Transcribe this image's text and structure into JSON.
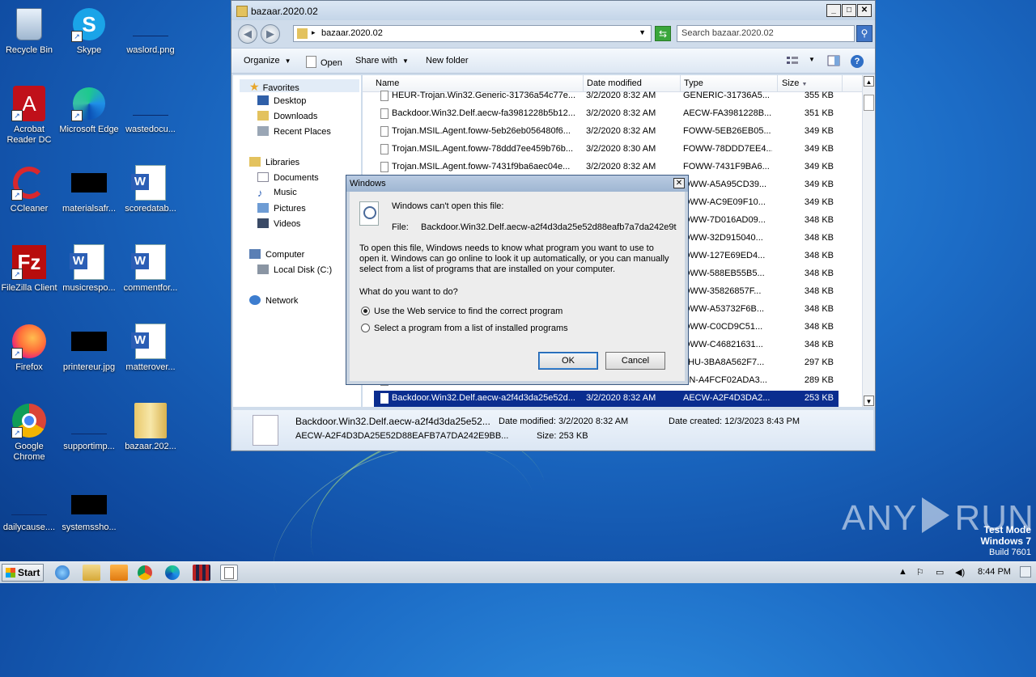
{
  "desktop": {
    "icons": [
      {
        "label": "Recycle Bin"
      },
      {
        "label": "Skype"
      },
      {
        "label": "waslord.png"
      },
      {
        "label": "Acrobat Reader DC"
      },
      {
        "label": "Microsoft Edge"
      },
      {
        "label": "wastedocu..."
      },
      {
        "label": "CCleaner"
      },
      {
        "label": "materialsafr..."
      },
      {
        "label": "scoredatab..."
      },
      {
        "label": "FileZilla Client"
      },
      {
        "label": "musicrespo..."
      },
      {
        "label": "commentfor..."
      },
      {
        "label": "Firefox"
      },
      {
        "label": "printereur.jpg"
      },
      {
        "label": "matterover..."
      },
      {
        "label": "Google Chrome"
      },
      {
        "label": "supportimp..."
      },
      {
        "label": "bazaar.202..."
      },
      {
        "label": "dailycause...."
      },
      {
        "label": "systemssho..."
      }
    ]
  },
  "explorer": {
    "title": "bazaar.2020.02",
    "address": "bazaar.2020.02",
    "search_placeholder": "Search bazaar.2020.02",
    "commands": {
      "organize": "Organize",
      "open": "Open",
      "share_with": "Share with",
      "new_folder": "New folder"
    },
    "nav": {
      "favorites": "Favorites",
      "desktop": "Desktop",
      "downloads": "Downloads",
      "recent_places": "Recent Places",
      "libraries": "Libraries",
      "documents": "Documents",
      "music": "Music",
      "pictures": "Pictures",
      "videos": "Videos",
      "computer": "Computer",
      "local_disk": "Local Disk (C:)",
      "network": "Network"
    },
    "columns": {
      "name": "Name",
      "date_modified": "Date modified",
      "type": "Type",
      "size": "Size"
    },
    "rows": [
      {
        "name": "HEUR-Trojan.Win32.Generic-31736a54c77e...",
        "date": "3/2/2020 8:32 AM",
        "type": "GENERIC-31736A5...",
        "size": "355 KB"
      },
      {
        "name": "Backdoor.Win32.Delf.aecw-fa3981228b5b12...",
        "date": "3/2/2020 8:32 AM",
        "type": "AECW-FA3981228B...",
        "size": "351 KB"
      },
      {
        "name": "Trojan.MSIL.Agent.foww-5eb26eb056480f6...",
        "date": "3/2/2020 8:32 AM",
        "type": "FOWW-5EB26EB05...",
        "size": "349 KB"
      },
      {
        "name": "Trojan.MSIL.Agent.foww-78ddd7ee459b76b...",
        "date": "3/2/2020 8:30 AM",
        "type": "FOWW-78DDD7EE4...",
        "size": "349 KB"
      },
      {
        "name": "Trojan.MSIL.Agent.foww-7431f9ba6aec04e...",
        "date": "3/2/2020 8:32 AM",
        "type": "FOWW-7431F9BA6...",
        "size": "349 KB"
      },
      {
        "name": "",
        "date": "",
        "type": "OWW-A5A95CD39...",
        "size": "349 KB"
      },
      {
        "name": "",
        "date": "",
        "type": "OWW-AC9E09F10...",
        "size": "349 KB"
      },
      {
        "name": "",
        "date": "",
        "type": "OWW-7D016AD09...",
        "size": "348 KB"
      },
      {
        "name": "",
        "date": "",
        "type": "OWW-32D915040...",
        "size": "348 KB"
      },
      {
        "name": "",
        "date": "",
        "type": "OWW-127E69ED4...",
        "size": "348 KB"
      },
      {
        "name": "",
        "date": "",
        "type": "OWW-588EB55B5...",
        "size": "348 KB"
      },
      {
        "name": "",
        "date": "",
        "type": "OWW-35826857F...",
        "size": "348 KB"
      },
      {
        "name": "",
        "date": "",
        "type": "OWW-A53732F6B...",
        "size": "348 KB"
      },
      {
        "name": "",
        "date": "",
        "type": "OWW-C0CD9C51...",
        "size": "348 KB"
      },
      {
        "name": "",
        "date": "",
        "type": "OWW-C46821631...",
        "size": "348 KB"
      },
      {
        "name": "",
        "date": "",
        "type": "LHU-3BA8A562F7...",
        "size": "297 KB"
      },
      {
        "name": "",
        "date": "",
        "type": "EN-A4FCF02ADA3...",
        "size": "289 KB"
      },
      {
        "name": "Backdoor.Win32.Delf.aecw-a2f4d3da25e52d...",
        "date": "3/2/2020 8:32 AM",
        "type": "AECW-A2F4D3DA2...",
        "size": "253 KB"
      }
    ],
    "details": {
      "filename": "Backdoor.Win32.Delf.aecw-a2f4d3da25e52...",
      "date_modified": "Date modified: 3/2/2020 8:32 AM",
      "date_created": "Date created: 12/3/2023 8:43 PM",
      "type": "AECW-A2F4D3DA25E52D88EAFB7A7DA242E9BB...",
      "size": "Size: 253 KB"
    }
  },
  "dialog": {
    "title": "Windows",
    "heading": "Windows can't open this file:",
    "file_label": "File:",
    "file_name": "Backdoor.Win32.Delf.aecw-a2f4d3da25e52d88eafb7a7da242e9t",
    "line1": "To open this file, Windows needs to know what program you want to use to",
    "line2": "open it. Windows can go online to look it up automatically, or you can manually",
    "line3": "select from a list of programs that are installed on your computer.",
    "question": "What do you want to do?",
    "option_web": "Use the Web service to find the correct program",
    "option_list": "Select a program from a list of installed programs",
    "ok": "OK",
    "cancel": "Cancel"
  },
  "watermark": {
    "left": "ANY",
    "right": "RUN",
    "test_mode": "Test Mode",
    "os": "Windows 7",
    "build": "Build 7601"
  },
  "taskbar": {
    "start": "Start",
    "time": "8:44 PM"
  }
}
